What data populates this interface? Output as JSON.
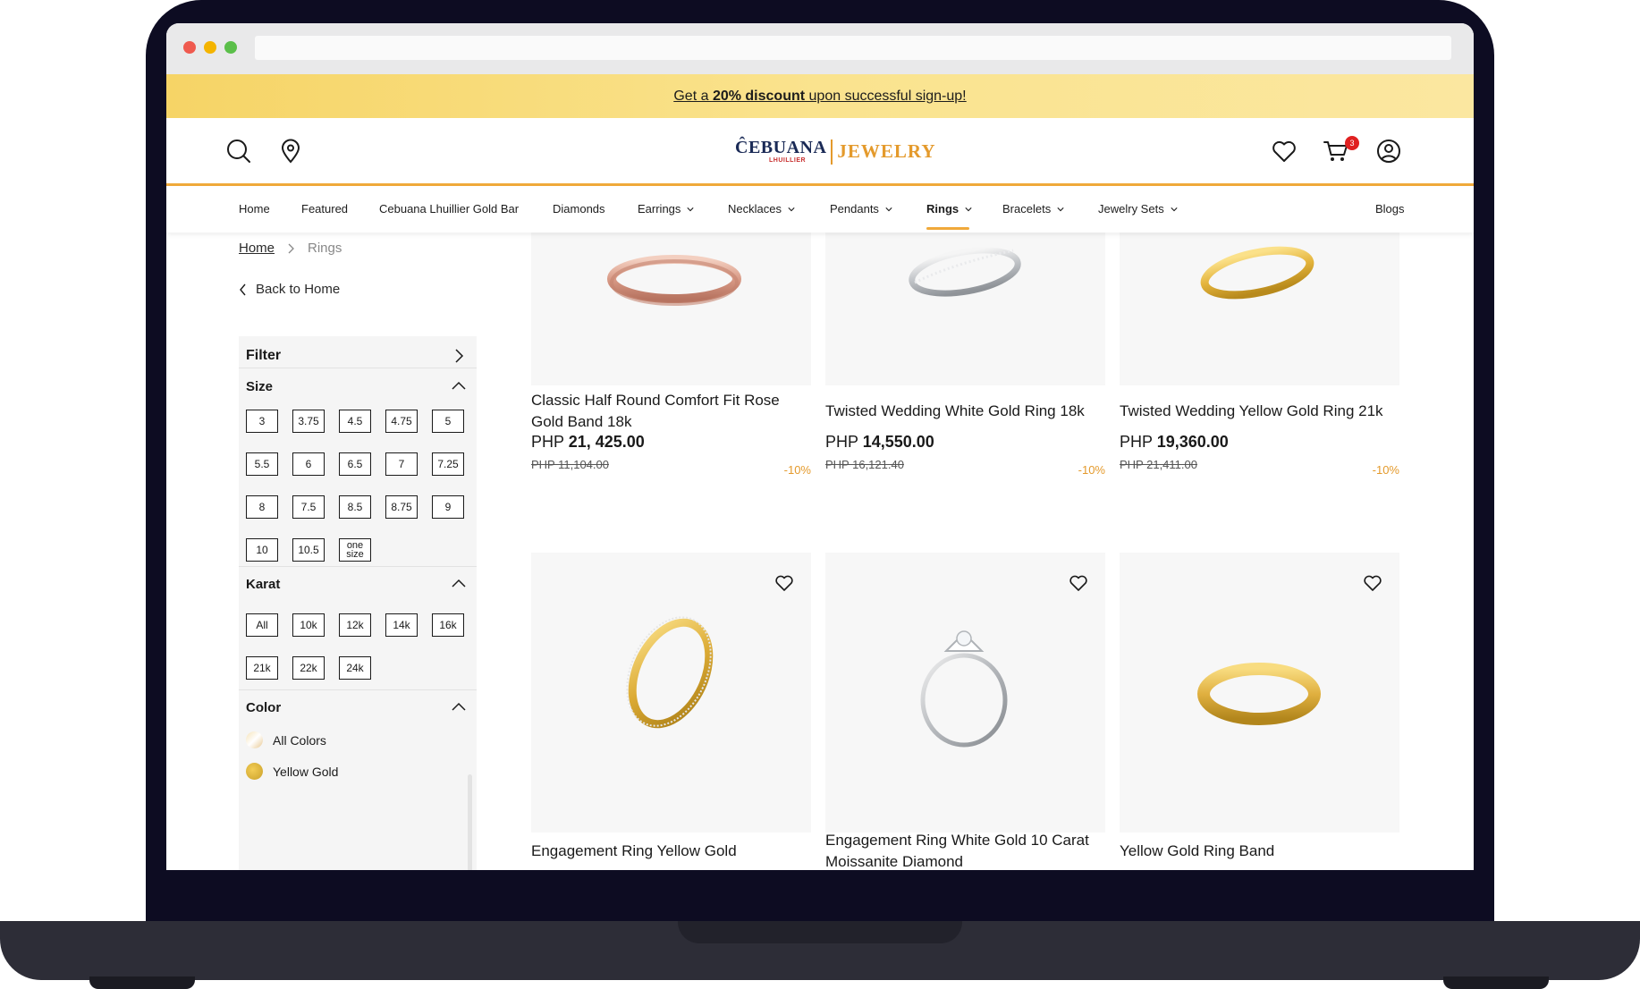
{
  "promo": {
    "prefix": "Get a ",
    "bold": "20% discount",
    "suffix": " upon successful sign-up!"
  },
  "logo": {
    "left": "ĈEBUANA",
    "sub": "LHUILLIER",
    "right": "JEWELRY"
  },
  "header": {
    "cart_count": "3"
  },
  "nav": [
    {
      "label": "Home"
    },
    {
      "label": "Featured"
    },
    {
      "label": "Cebuana Lhuillier Gold Bar"
    },
    {
      "label": "Diamonds"
    },
    {
      "label": "Earrings"
    },
    {
      "label": "Necklaces"
    },
    {
      "label": "Pendants"
    },
    {
      "label": "Rings"
    },
    {
      "label": "Bracelets"
    },
    {
      "label": "Jewelry Sets"
    },
    {
      "label": "Blogs"
    }
  ],
  "breadcrumb": {
    "home": "Home",
    "current": "Rings"
  },
  "back": "Back to Home",
  "filter": {
    "title": "Filter",
    "size_title": "Size",
    "sizes": [
      "3",
      "3.75",
      "4.5",
      "4.75",
      "5",
      "5.5",
      "6",
      "6.5",
      "7",
      "7.25",
      "8",
      "7.5",
      "8.5",
      "8.75",
      "9",
      "10",
      "10.5",
      "one size"
    ],
    "karat_title": "Karat",
    "karats": [
      "All",
      "10k",
      "12k",
      "14k",
      "16k",
      "21k",
      "22k",
      "24k"
    ],
    "color_title": "Color",
    "colors": [
      {
        "label": "All Colors"
      },
      {
        "label": "Yellow Gold"
      }
    ]
  },
  "products": [
    {
      "name": "Classic Half Round Comfort Fit Rose Gold Band 18k",
      "currency": "PHP",
      "price": "21, 425.00",
      "old_price": "PHP 11,104.00",
      "discount": "-10%"
    },
    {
      "name": "Twisted Wedding White Gold Ring 18k",
      "currency": "PHP",
      "price": "14,550.00",
      "old_price": "PHP 16,121.40",
      "discount": "-10%"
    },
    {
      "name": "Twisted Wedding Yellow Gold Ring 21k",
      "currency": "PHP",
      "price": "19,360.00",
      "old_price": "PHP 21,411.00",
      "discount": "-10%"
    },
    {
      "name": "Engagement Ring Yellow Gold"
    },
    {
      "name": "Engagement Ring White Gold 10 Carat Moissanite Diamond"
    },
    {
      "name": "Yellow Gold Ring Band"
    }
  ],
  "colors": {
    "accent": "#f0a93a",
    "navy": "#1a2a56",
    "logo_red": "#c8302f",
    "discount": "#e49a2c"
  }
}
